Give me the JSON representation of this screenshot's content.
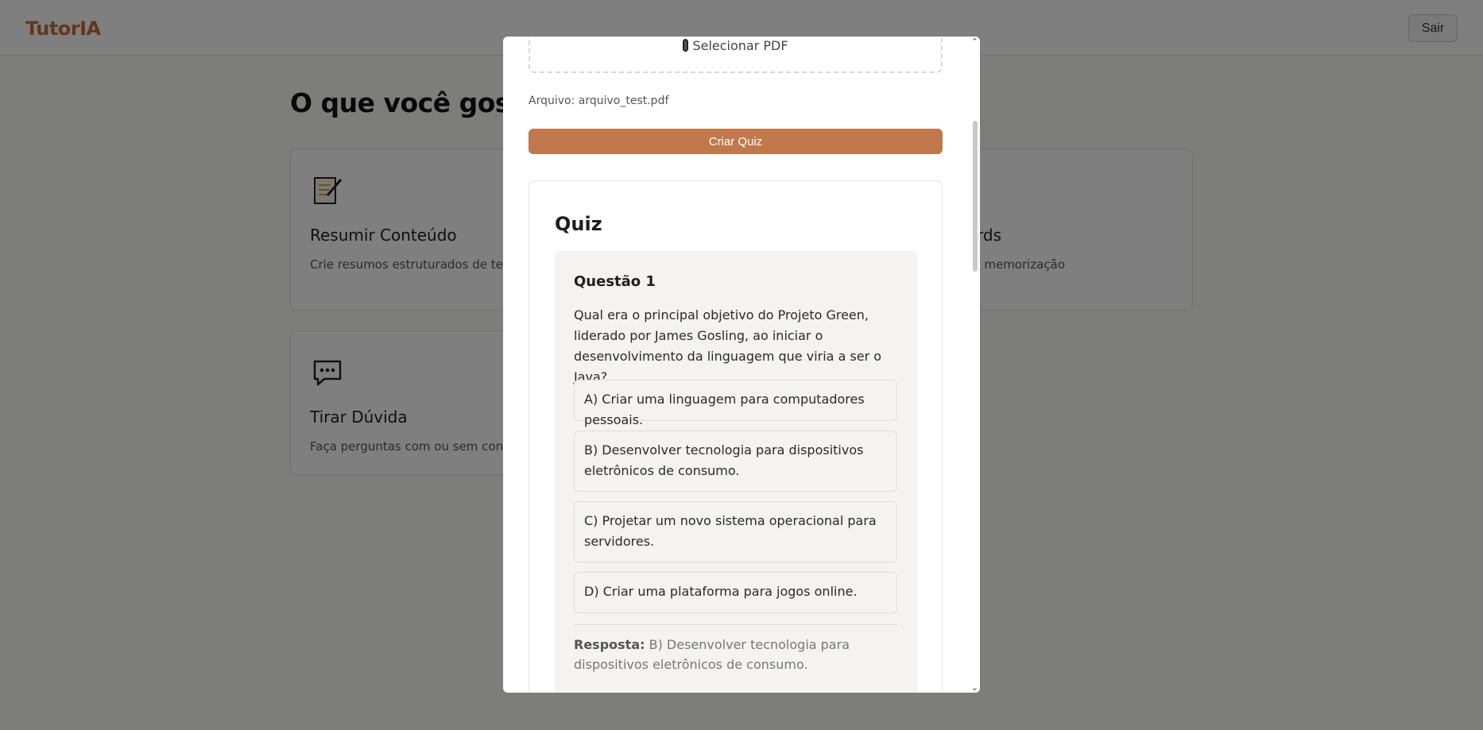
{
  "app": {
    "logo": "TutorIA",
    "logout_label": "Sair"
  },
  "main": {
    "heading": "O que você gostar",
    "cards": [
      {
        "title": "Resumir Conteúdo",
        "description": "Crie resumos estruturados de textos",
        "icon": "document-edit-icon"
      },
      {
        "title": "rds",
        "description": "es de estudo para memorização",
        "icon": "flashcards-icon"
      },
      {
        "title": "Tirar Dúvida",
        "description": "Faça perguntas com ou sem contexto",
        "icon": "speech-bubble-icon"
      }
    ]
  },
  "modal": {
    "select_pdf_label": "Selecionar PDF",
    "file_label": "Arquivo: arquivo_test.pdf",
    "create_button": "Criar Quiz",
    "quiz": {
      "title": "Quiz",
      "questions": [
        {
          "title": "Questão 1",
          "text": "Qual era o principal objetivo do Projeto Green, liderado por James Gosling, ao iniciar o desenvolvimento da linguagem que viria a ser o Java?",
          "options": [
            "A) Criar uma linguagem para computadores pessoais.",
            "B) Desenvolver tecnologia para dispositivos eletrônicos de consumo.",
            "C) Projetar um novo sistema operacional para servidores.",
            "D) Criar uma plataforma para jogos online."
          ],
          "answer_label": "Resposta:",
          "answer_text": "B) Desenvolver tecnologia para dispositivos eletrônicos de consumo."
        }
      ]
    }
  },
  "colors": {
    "accent": "#c1784c",
    "logo": "#c1703c",
    "question_bg": "#f4f3ef"
  }
}
